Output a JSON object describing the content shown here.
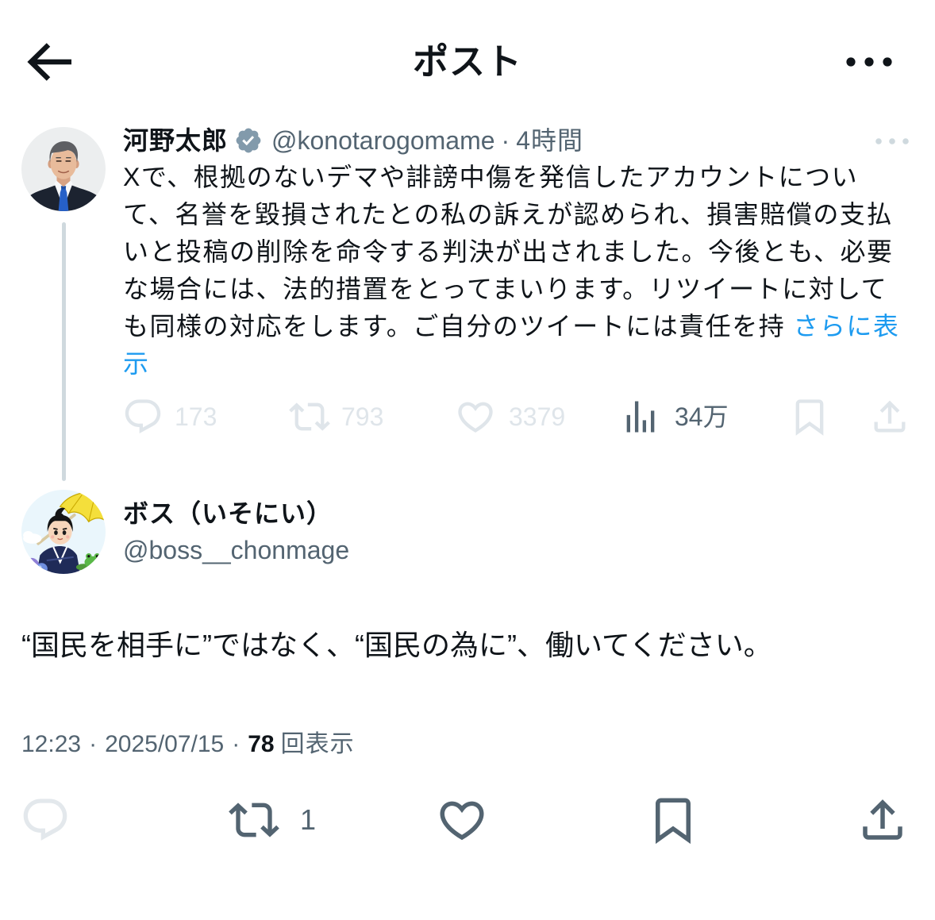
{
  "header": {
    "title": "ポスト"
  },
  "parent_tweet": {
    "author_name": "河野太郎",
    "verified": true,
    "handle": "@konotarogomame",
    "separator": "·",
    "time": "4時間",
    "body": "Xで、根拠のないデマや誹謗中傷を発信したアカウントについて、名誉を毀損されたとの私の訴えが認められ、損害賠償の支払いと投稿の削除を命令する判決が出されました。今後とも、必要な場合には、法的措置をとってまいります。リツイートに対しても同様の対応をします。ご自分のツイートには責任を持",
    "show_more": "さらに表示",
    "stats": {
      "replies": "173",
      "retweets": "793",
      "likes": "3379",
      "views": "34万"
    }
  },
  "reply_tweet": {
    "author_name": "ボス（いそにい）",
    "handle": "@boss__chonmage",
    "body": "“国民を相手に”ではなく、“国民の為に”、働いてください。",
    "timestamp": {
      "time": "12:23",
      "separator": "·",
      "date": "2025/07/15",
      "views_count": "78",
      "views_label": "回表示"
    },
    "stats": {
      "retweets": "1"
    }
  },
  "icons": {
    "back": "arrow-left-icon",
    "more": "more-horizontal-icon",
    "verified": "verified-badge-icon",
    "reply": "reply-icon",
    "retweet": "retweet-icon",
    "like": "heart-icon",
    "views": "views-icon",
    "bookmark": "bookmark-icon",
    "share": "share-icon"
  },
  "colors": {
    "text": "#0f1419",
    "secondary": "#536471",
    "link": "#1d9bf0",
    "faded": "#dfe5ea",
    "thread_line": "#cfd9de",
    "verified_badge": "#829aab"
  }
}
